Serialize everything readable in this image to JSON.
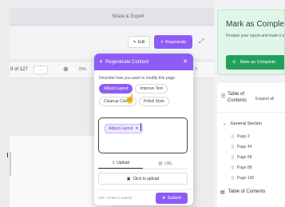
{
  "editor": {
    "share_export": "Share & Export",
    "edit_label": "Edit",
    "regenerate_label": "Regenerate",
    "page_info": "9 of 127",
    "page_btn": "...",
    "zoom": "75%"
  },
  "popup": {
    "title": "Regenerate Content",
    "description": "Describe how you want to modify this page",
    "chips": [
      "Adjust Layout",
      "Improve Text",
      "Cleanup Clutter",
      "Polish Style"
    ],
    "tag_label": "Adjust Layout",
    "tabs": {
      "upload": "Upload",
      "url": "URL"
    },
    "upload_label": "Click to upload",
    "hint": "Ctrl + Enter to submit",
    "submit_label": "Submit"
  },
  "complete": {
    "title": "Mark as Complete",
    "description": "Finalize your report and mark it as complete",
    "button_label": "Mark as Complete"
  },
  "toc": {
    "title": "Table of Contents",
    "expand_label": "Expand all",
    "section": "General Section",
    "items": [
      "Page 2",
      "Page 44",
      "Page 68",
      "Page 88",
      "Page 106"
    ],
    "bottom_label": "Table of Contents"
  },
  "colors": {
    "accent": "#8d5cf6",
    "success": "#23a05a"
  }
}
